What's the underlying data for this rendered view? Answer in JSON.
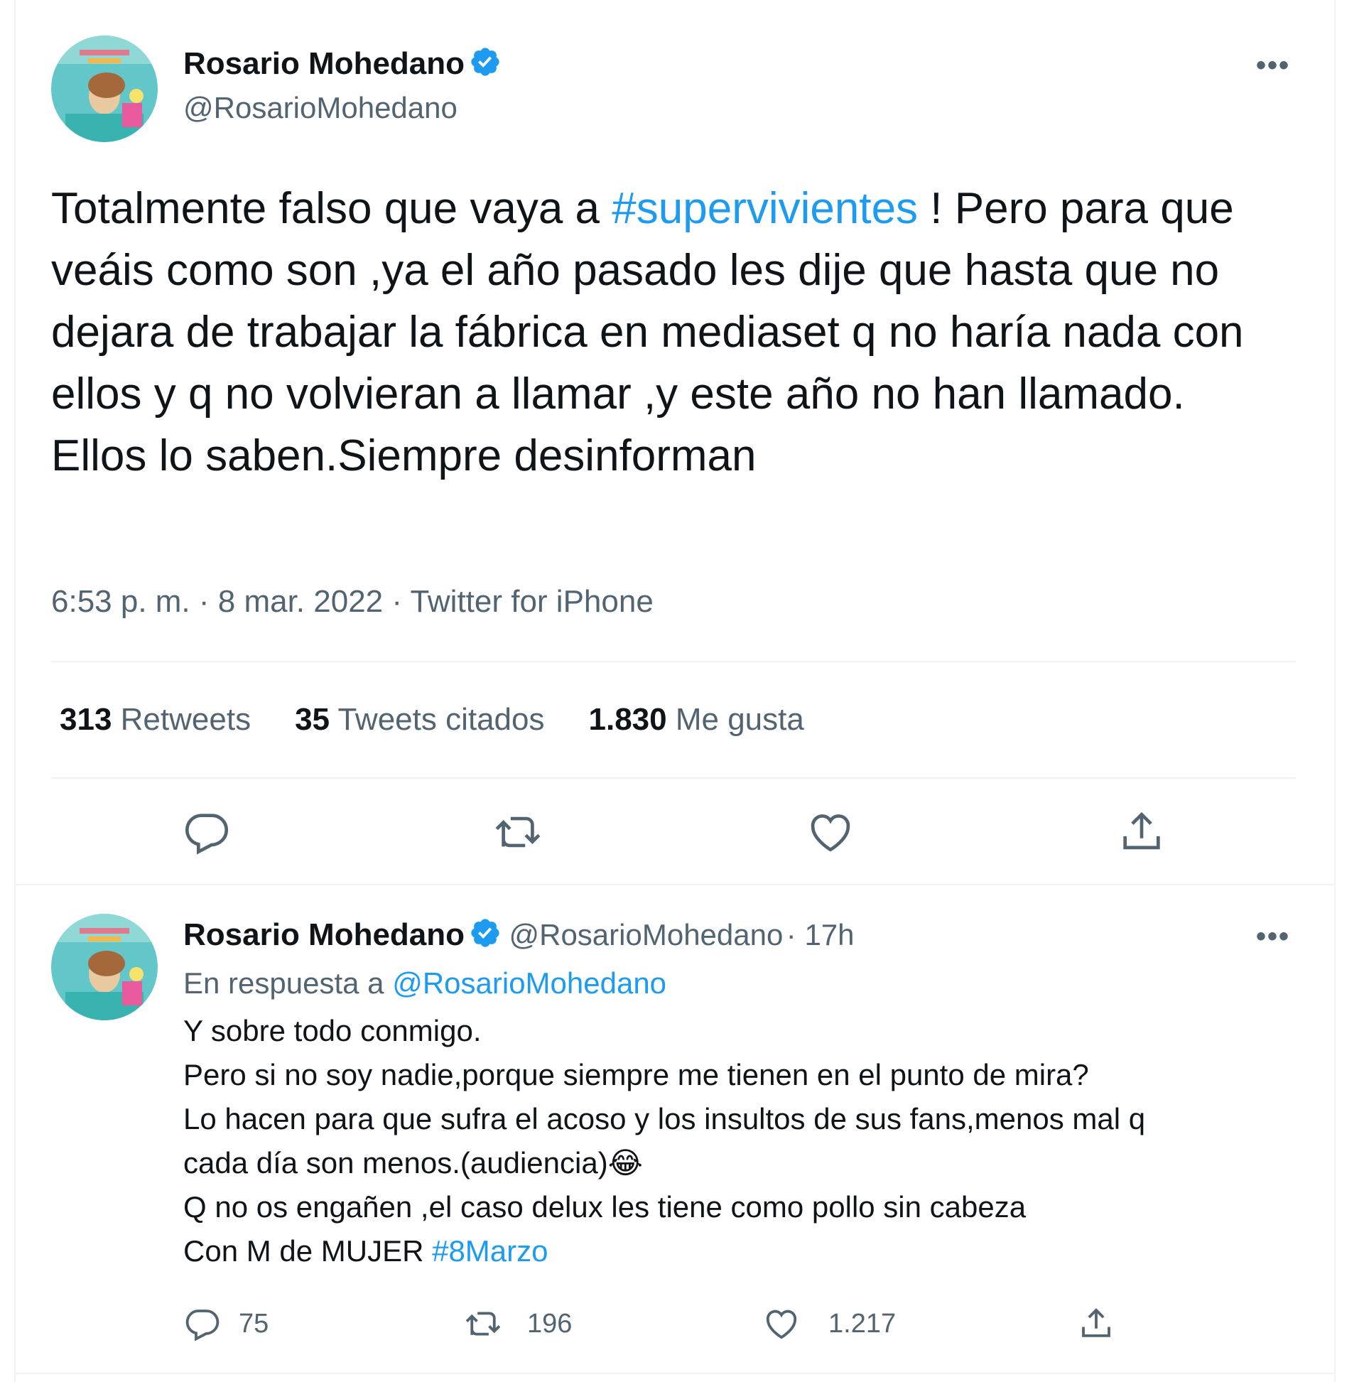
{
  "tweet": {
    "author_name": "Rosario Mohedano",
    "author_handle": "@RosarioMohedano",
    "more_label": "•••",
    "text_before_hashtag": "Totalmente falso que vaya a ",
    "hashtag": "#supervivientes",
    "text_after_hashtag": " ! Pero para que veáis como son ,ya el año pasado les dije que hasta que no dejara de trabajar la fábrica en mediaset q no haría nada con ellos y q no volvieran a llamar ,y este año no han llamado.",
    "text_line_last": "Ellos lo saben.Siempre desinforman",
    "meta": "6:53 p. m. · 8 mar. 2022 · Twitter for iPhone",
    "stats": {
      "retweets_count": "313",
      "retweets_label": "Retweets",
      "quotes_count": "35",
      "quotes_label": "Tweets citados",
      "likes_count": "1.830",
      "likes_label": "Me gusta"
    },
    "actions": [
      "reply-icon",
      "retweet-icon",
      "like-icon",
      "share-icon"
    ]
  },
  "reply": {
    "author_name": "Rosario Mohedano",
    "author_handle": "@RosarioMohedano",
    "time": "· 17h",
    "more_label": "•••",
    "in_reply_prefix": "En respuesta a ",
    "in_reply_mention": "@RosarioMohedano",
    "lines": [
      "Y sobre todo conmigo.",
      "Pero si no soy nadie,porque siempre me tienen en el punto de mira?",
      "Lo hacen para que sufra el acoso y los insultos de sus fans,menos mal q",
      "cada día son menos.(audiencia)😂",
      "Q no os engañen ,el caso delux les tiene como pollo sin cabeza"
    ],
    "last_line_prefix": "Con M de MUJER ",
    "last_line_hashtag": "#8Marzo",
    "counts": {
      "replies": "75",
      "retweets": "196",
      "likes": "1.217"
    }
  },
  "colors": {
    "accent": "#1d9bf0",
    "secondary_text": "#536471",
    "divider": "#eff3f4"
  }
}
